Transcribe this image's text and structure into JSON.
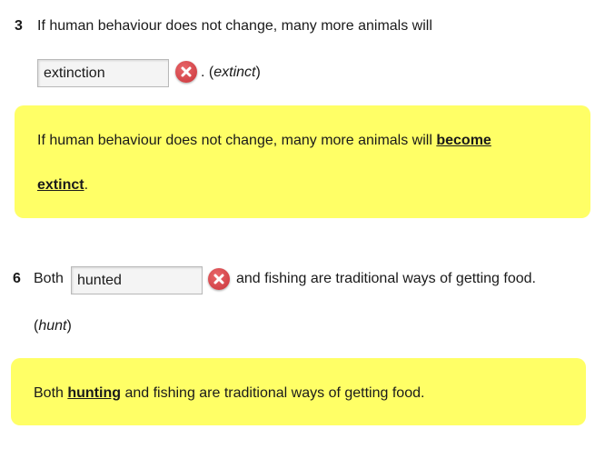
{
  "q3": {
    "number": "3",
    "prompt": "If human behaviour does not change, many more animals will",
    "input_value": "extinction",
    "after_input": ". (",
    "hint": "extinct",
    "hint_close": ")",
    "feedback": {
      "before": "If human behaviour does not change, many more animals will ",
      "answer_line1": "become",
      "answer_line2": "extinct",
      "after": "."
    }
  },
  "q6": {
    "number": "6",
    "before_input": "Both",
    "input_value": "hunted",
    "after_input": "and fishing are traditional ways of getting food.",
    "hint_open": "(",
    "hint": "hunt",
    "hint_close": ")",
    "feedback": {
      "before": "Both ",
      "answer": "hunting",
      "after": " and fishing are traditional ways of getting food."
    }
  },
  "colors": {
    "feedback_bg": "#ffff66",
    "wrong_icon": "#d9434a"
  },
  "icons": {
    "wrong": "wrong-answer-icon"
  }
}
